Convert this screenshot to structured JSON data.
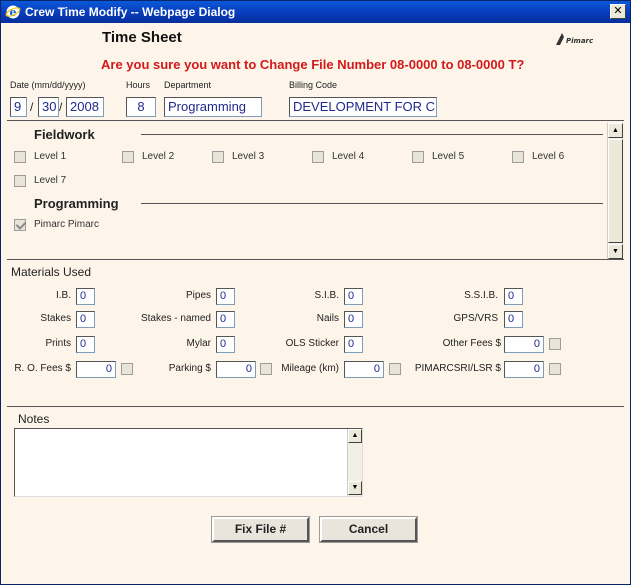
{
  "window": {
    "title": "Crew Time Modify -- Webpage Dialog",
    "close_glyph": "✕"
  },
  "header": {
    "title": "Time Sheet",
    "confirm_message": "Are you sure you want to Change File Number 08-0000 to 08-0000 T?",
    "logo_text": "Pimarc"
  },
  "form": {
    "date_label": "Date (mm/dd/yyyy)",
    "date_month": "9",
    "date_day": "30",
    "date_year": "2008",
    "date_sep": "/",
    "hours_label": "Hours",
    "hours_value": "8",
    "department_label": "Department",
    "department_value": "Programming",
    "billing_label": "Billing Code",
    "billing_value": "DEVELOPMENT FOR CL"
  },
  "groups": {
    "fieldwork": {
      "title": "Fieldwork",
      "items": [
        {
          "label": "Level 1",
          "checked": false
        },
        {
          "label": "Level 2",
          "checked": false
        },
        {
          "label": "Level 3",
          "checked": false
        },
        {
          "label": "Level 4",
          "checked": false
        },
        {
          "label": "Level 5",
          "checked": false
        },
        {
          "label": "Level 6",
          "checked": false
        },
        {
          "label": "Level 7",
          "checked": false
        }
      ]
    },
    "programming": {
      "title": "Programming",
      "items": [
        {
          "label": "Pimarc Pimarc",
          "checked": true
        }
      ]
    }
  },
  "materials": {
    "title": "Materials Used",
    "ib": {
      "label": "I.B.",
      "value": "0"
    },
    "pipes": {
      "label": "Pipes",
      "value": "0"
    },
    "sib": {
      "label": "S.I.B.",
      "value": "0"
    },
    "ssib": {
      "label": "S.S.I.B.",
      "value": "0"
    },
    "stakes": {
      "label": "Stakes",
      "value": "0"
    },
    "stakes_named": {
      "label": "Stakes - named",
      "value": "0"
    },
    "nails": {
      "label": "Nails",
      "value": "0"
    },
    "gps": {
      "label": "GPS/VRS",
      "value": "0"
    },
    "prints": {
      "label": "Prints",
      "value": "0"
    },
    "mylar": {
      "label": "Mylar",
      "value": "0"
    },
    "ols": {
      "label": "OLS Sticker",
      "value": "0"
    },
    "other_fees": {
      "label": "Other Fees  $",
      "value": "0"
    },
    "ro_fees": {
      "label": "R. O. Fees  $",
      "value": "0"
    },
    "parking": {
      "label": "Parking  $",
      "value": "0"
    },
    "mileage": {
      "label": "Mileage (km)",
      "value": "0"
    },
    "pimarcsri": {
      "label": "PIMARCSRI/LSR  $",
      "value": "0"
    }
  },
  "notes": {
    "title": "Notes",
    "value": ""
  },
  "buttons": {
    "fix": "Fix File #",
    "cancel": "Cancel"
  },
  "colors": {
    "accent_red": "#d21a1a",
    "titlebar": "#0839b8",
    "background": "#fdf5e9"
  }
}
